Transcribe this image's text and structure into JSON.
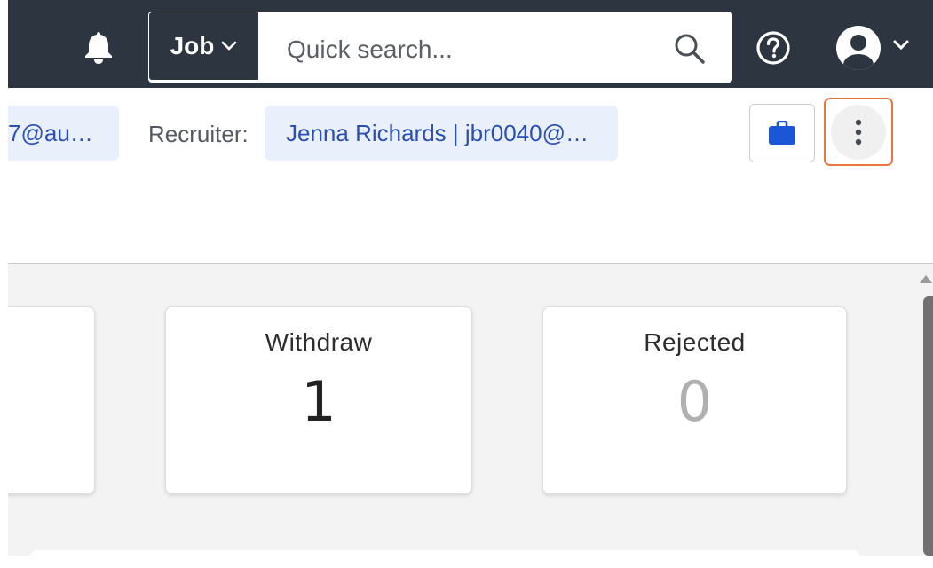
{
  "topbar": {
    "search_type": "Job",
    "search_placeholder": "Quick search...",
    "icons": [
      "bell-icon",
      "chevron-down-icon",
      "search-icon",
      "help-icon",
      "user-avatar-icon"
    ]
  },
  "job_info": {
    "contact_email_truncated": "7@au…",
    "recruiter_label": "Recruiter:",
    "recruiter_value": "Jenna Richards | jbr0040@…",
    "actions": [
      "briefcase-icon",
      "more-vertical-icon"
    ]
  },
  "stats": {
    "withdraw": {
      "label": "Withdraw",
      "value": "1"
    },
    "rejected": {
      "label": "Rejected",
      "value": "0"
    }
  },
  "colors": {
    "topbar_bg": "#2d3540",
    "chip_bg": "#eaf0fb",
    "chip_text": "#2b4fb4",
    "briefcase": "#1a56d6",
    "highlight": "#e8763f",
    "value_dark": "#222222",
    "value_muted": "#b0b0b0"
  }
}
